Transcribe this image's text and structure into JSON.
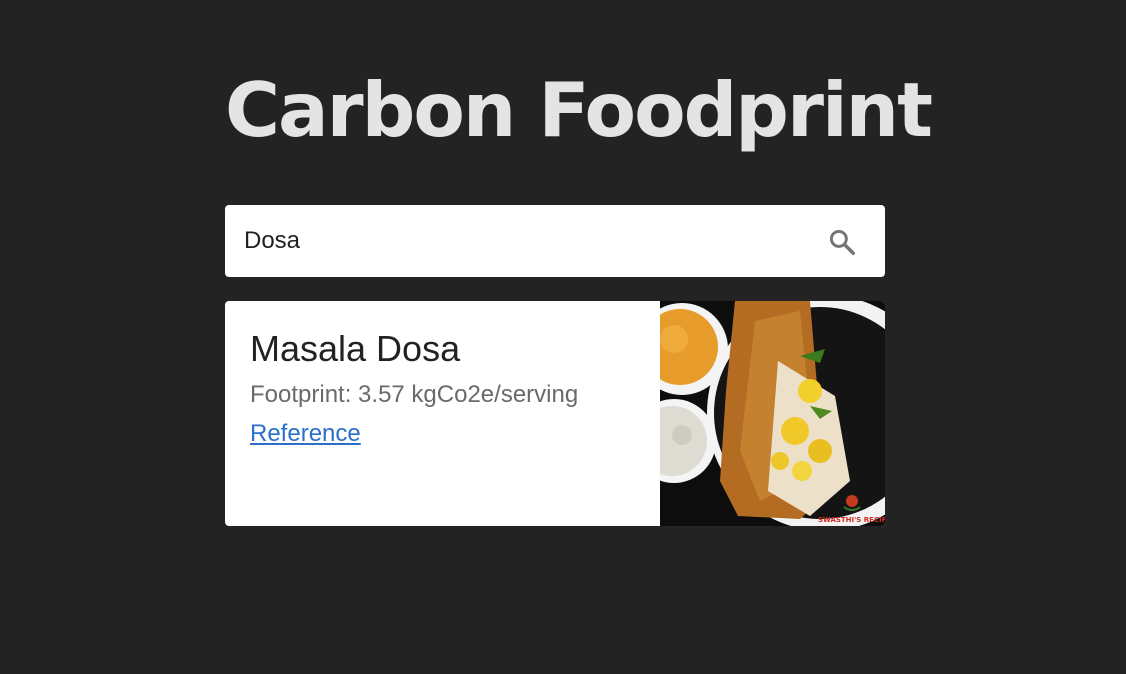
{
  "app": {
    "title": "Carbon Foodprint"
  },
  "search": {
    "value": "Dosa",
    "icon": "search-icon"
  },
  "results": [
    {
      "name": "Masala Dosa",
      "footprint_text": "Footprint: 3.57 kgCo2e/serving",
      "link_label": "Reference",
      "image_watermark": "SWASTHI'S RECIPES"
    }
  ],
  "colors": {
    "background": "#232323",
    "title": "#e4e4e4",
    "link": "#2a6fc9"
  }
}
